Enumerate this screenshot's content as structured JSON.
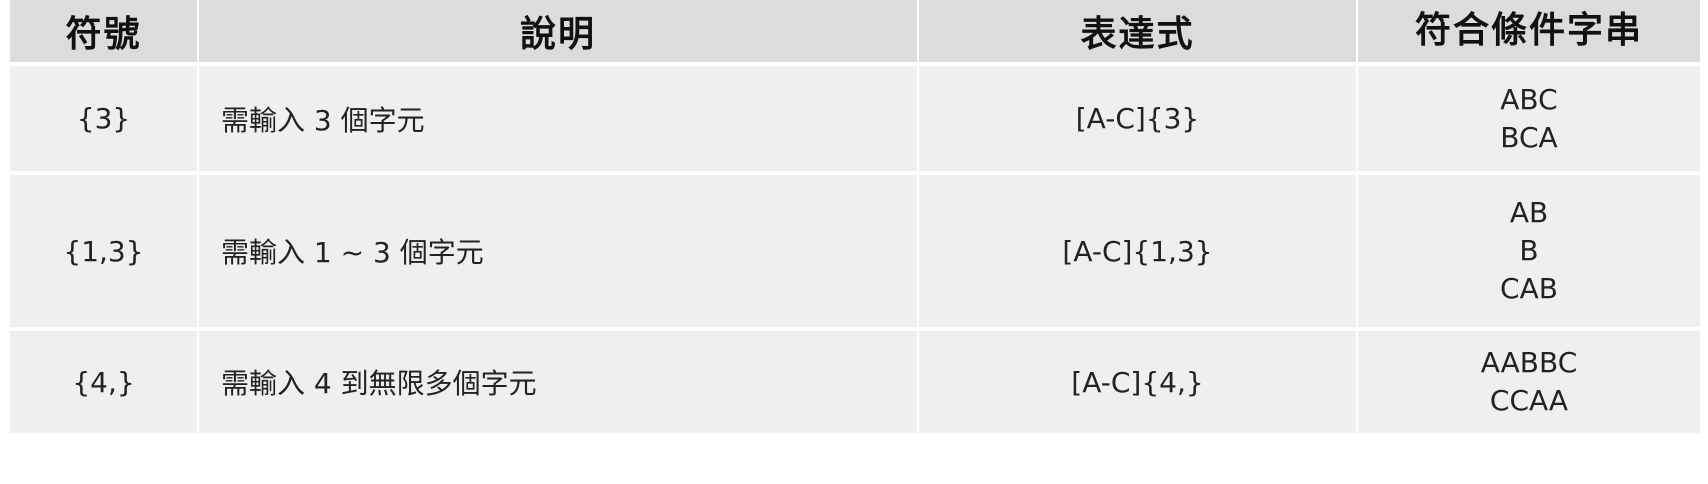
{
  "table": {
    "headers": [
      "符號",
      "說明",
      "表達式",
      "符合條件字串"
    ],
    "rows": [
      {
        "symbol": "{3}",
        "description": "需輸入 3 個字元",
        "expression": "[A-C]{3}",
        "matches": [
          "ABC",
          "BCA"
        ]
      },
      {
        "symbol": "{1,3}",
        "description": "需輸入 1 ~ 3 個字元",
        "expression": "[A-C]{1,3}",
        "matches": [
          "AB",
          "B",
          "CAB"
        ]
      },
      {
        "symbol": "{4,}",
        "description": "需輸入 4 到無限多個字元",
        "expression": "[A-C]{4,}",
        "matches": [
          "AABBC",
          "CCAA"
        ]
      }
    ]
  },
  "colors": {
    "header_bg": "#dcdcdc",
    "cell_bg": "#efefef",
    "divider": "#ffffff"
  }
}
